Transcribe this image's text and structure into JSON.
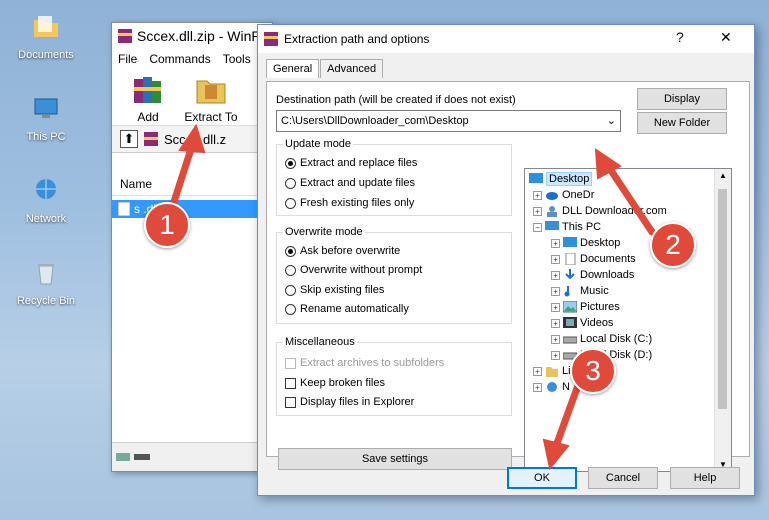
{
  "desktop": {
    "icons": [
      {
        "label": "Documents"
      },
      {
        "label": "This PC"
      },
      {
        "label": "Network"
      },
      {
        "label": "Recycle Bin"
      }
    ]
  },
  "winrar": {
    "title": "Sccex.dll.zip - WinR",
    "menu": [
      "File",
      "Commands",
      "Tools"
    ],
    "toolbar": {
      "add": "Add",
      "extract_to": "Extract To"
    },
    "address": "Sccex.dll.z",
    "list_header": "Name",
    "selected_file": "s        .dll"
  },
  "dialog": {
    "title": "Extraction path and options",
    "help": "?",
    "close": "✕",
    "tabs": [
      "General",
      "Advanced"
    ],
    "dest_label": "Destination path (will be created if does not exist)",
    "dest_value": "C:\\Users\\DllDownloader_com\\Desktop",
    "display_btn": "Display",
    "new_folder_btn": "New Folder",
    "update_mode": {
      "title": "Update mode",
      "options": [
        "Extract and replace files",
        "Extract and update files",
        "Fresh existing files only"
      ],
      "selected": 0
    },
    "overwrite_mode": {
      "title": "Overwrite mode",
      "options": [
        "Ask before overwrite",
        "Overwrite without prompt",
        "Skip existing files",
        "Rename automatically"
      ],
      "selected": 0
    },
    "misc": {
      "title": "Miscellaneous",
      "options": [
        "Extract archives to subfolders",
        "Keep broken files",
        "Display files in Explorer"
      ]
    },
    "save_settings": "Save settings",
    "tree": [
      {
        "label": "Desktop",
        "selected": true
      },
      {
        "label": "OneDr"
      },
      {
        "label": "DLL Downloader.com"
      },
      {
        "label": "This PC"
      },
      {
        "label": "Desktop"
      },
      {
        "label": "Documents"
      },
      {
        "label": "Downloads"
      },
      {
        "label": "Music"
      },
      {
        "label": "Pictures"
      },
      {
        "label": "Videos"
      },
      {
        "label": "Local Disk (C:)"
      },
      {
        "label": "Local Disk (D:)"
      },
      {
        "label": "Libraries"
      },
      {
        "label": "N"
      }
    ],
    "ok": "OK",
    "cancel": "Cancel",
    "help_btn": "Help"
  },
  "callouts": [
    "1",
    "2",
    "3"
  ],
  "colors": {
    "callout": "#e04a3b",
    "selection": "#3399ff"
  }
}
